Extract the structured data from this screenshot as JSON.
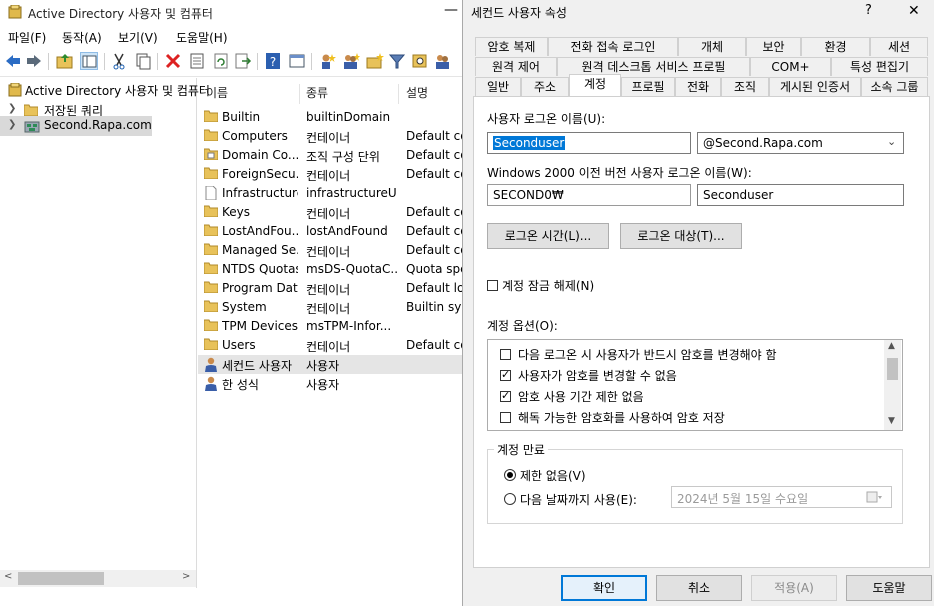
{
  "main": {
    "title": "Active Directory 사용자 및 컴퓨터",
    "menus": [
      "파일(F)",
      "동작(A)",
      "보기(V)",
      "도움말(H)"
    ],
    "tree": {
      "root": "Active Directory 사용자 및 컴퓨터",
      "saved_queries": "저장된 쿼리",
      "domain": "Second.Rapa.com"
    },
    "list": {
      "headers": [
        "이름",
        "종류",
        "설명"
      ],
      "rows": [
        {
          "name": "Builtin",
          "type": "builtinDomain",
          "desc": "",
          "icon": "folder-icon"
        },
        {
          "name": "Computers",
          "type": "컨테이너",
          "desc": "Default co",
          "icon": "folder-icon"
        },
        {
          "name": "Domain Co...",
          "type": "조직 구성 단위",
          "desc": "Default co",
          "icon": "ou-icon"
        },
        {
          "name": "ForeignSecu...",
          "type": "컨테이너",
          "desc": "Default co",
          "icon": "folder-icon"
        },
        {
          "name": "Infrastructure",
          "type": "infrastructureU...",
          "desc": "",
          "icon": "document-icon"
        },
        {
          "name": "Keys",
          "type": "컨테이너",
          "desc": "Default co",
          "icon": "folder-icon"
        },
        {
          "name": "LostAndFou...",
          "type": "lostAndFound",
          "desc": "Default co",
          "icon": "folder-icon"
        },
        {
          "name": "Managed Se...",
          "type": "컨테이너",
          "desc": "Default co",
          "icon": "folder-icon"
        },
        {
          "name": "NTDS Quotas",
          "type": "msDS-QuotaC...",
          "desc": "Quota spe",
          "icon": "folder-icon"
        },
        {
          "name": "Program Data",
          "type": "컨테이너",
          "desc": "Default loc",
          "icon": "folder-icon"
        },
        {
          "name": "System",
          "type": "컨테이너",
          "desc": "Builtin syst",
          "icon": "folder-icon"
        },
        {
          "name": "TPM Devices",
          "type": "msTPM-Infor...",
          "desc": "",
          "icon": "folder-icon"
        },
        {
          "name": "Users",
          "type": "컨테이너",
          "desc": "Default co",
          "icon": "folder-icon"
        },
        {
          "name": "세컨드 사용자",
          "type": "사용자",
          "desc": "",
          "icon": "user-icon"
        },
        {
          "name": "한 성식",
          "type": "사용자",
          "desc": "",
          "icon": "user-icon"
        }
      ]
    }
  },
  "dialog": {
    "title": "세컨드 사용자 속성",
    "help_glyph": "?",
    "close_glyph": "✕",
    "tabs_row1": [
      "암호 복제",
      "전화 접속 로그인",
      "개체",
      "보안",
      "환경",
      "세션"
    ],
    "tabs_row2": [
      "원격 제어",
      "원격 데스크톱 서비스 프로필",
      "COM+",
      "특성 편집기"
    ],
    "tabs_row3": [
      "일반",
      "주소",
      "계정",
      "프로필",
      "전화",
      "조직",
      "게시된 인증서",
      "소속 그룹"
    ],
    "logon_name_label": "사용자 로그온 이름(U):",
    "logon_name_value": "Seconduser",
    "domain_suffix": "@Second.Rapa.com",
    "pre2000_label": "Windows 2000 이전 버전 사용자 로그온 이름(W):",
    "pre2000_domain": "SECOND0₩",
    "pre2000_user": "Seconduser",
    "logon_hours_button": "로그온 시간(L)...",
    "logon_to_button": "로그온 대상(T)...",
    "unlock_label": "계정 잠금 해제(N)",
    "options_label": "계정 옵션(O):",
    "options": [
      {
        "label": "다음 로그온 시 사용자가 반드시 암호를 변경해야 함",
        "checked": false
      },
      {
        "label": "사용자가 암호를 변경할 수 없음",
        "checked": true
      },
      {
        "label": "암호 사용 기간 제한 없음",
        "checked": true
      },
      {
        "label": "해독 가능한 암호화를 사용하여 암호 저장",
        "checked": false
      }
    ],
    "expires_group": "계정 만료",
    "never_label": "제한 없음(V)",
    "end_of_label": "다음 날짜까지 사용(E):",
    "expiry_date": "2024년   5월 15일 수요일",
    "buttons": {
      "ok": "확인",
      "cancel": "취소",
      "apply": "적용(A)",
      "help": "도움말"
    }
  },
  "colors": {
    "accent": "#0078d7",
    "selection_blue": "#3399ff",
    "folder": "#e8c25a"
  }
}
